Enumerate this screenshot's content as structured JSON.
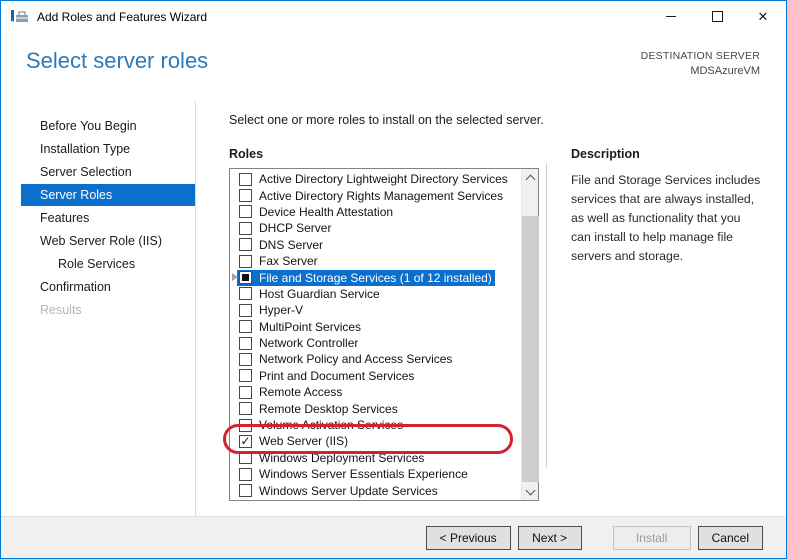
{
  "window": {
    "title": "Add Roles and Features Wizard"
  },
  "header": {
    "title": "Select server roles",
    "destination_label": "DESTINATION SERVER",
    "destination_server": "MDSAzureVM"
  },
  "sidebar": {
    "items": [
      {
        "label": "Before You Begin",
        "state": "normal"
      },
      {
        "label": "Installation Type",
        "state": "normal"
      },
      {
        "label": "Server Selection",
        "state": "normal"
      },
      {
        "label": "Server Roles",
        "state": "selected"
      },
      {
        "label": "Features",
        "state": "normal"
      },
      {
        "label": "Web Server Role (IIS)",
        "state": "normal"
      },
      {
        "label": "Role Services",
        "state": "normal",
        "indent": true
      },
      {
        "label": "Confirmation",
        "state": "normal"
      },
      {
        "label": "Results",
        "state": "disabled"
      }
    ]
  },
  "main": {
    "instruction": "Select one or more roles to install on the selected server.",
    "roles_label": "Roles",
    "roles": [
      {
        "label": "Active Directory Lightweight Directory Services",
        "checkbox": "unchecked"
      },
      {
        "label": "Active Directory Rights Management Services",
        "checkbox": "unchecked"
      },
      {
        "label": "Device Health Attestation",
        "checkbox": "unchecked"
      },
      {
        "label": "DHCP Server",
        "checkbox": "unchecked"
      },
      {
        "label": "DNS Server",
        "checkbox": "unchecked"
      },
      {
        "label": "Fax Server",
        "checkbox": "unchecked"
      },
      {
        "label": "File and Storage Services (1 of 12 installed)",
        "checkbox": "indeterminate",
        "selected": true,
        "expandable": true
      },
      {
        "label": "Host Guardian Service",
        "checkbox": "unchecked"
      },
      {
        "label": "Hyper-V",
        "checkbox": "unchecked"
      },
      {
        "label": "MultiPoint Services",
        "checkbox": "unchecked"
      },
      {
        "label": "Network Controller",
        "checkbox": "unchecked"
      },
      {
        "label": "Network Policy and Access Services",
        "checkbox": "unchecked"
      },
      {
        "label": "Print and Document Services",
        "checkbox": "unchecked"
      },
      {
        "label": "Remote Access",
        "checkbox": "unchecked"
      },
      {
        "label": "Remote Desktop Services",
        "checkbox": "unchecked"
      },
      {
        "label": "Volume Activation Services",
        "checkbox": "unchecked"
      },
      {
        "label": "Web Server (IIS)",
        "checkbox": "checked",
        "annotated": true
      },
      {
        "label": "Windows Deployment Services",
        "checkbox": "unchecked"
      },
      {
        "label": "Windows Server Essentials Experience",
        "checkbox": "unchecked"
      },
      {
        "label": "Windows Server Update Services",
        "checkbox": "unchecked"
      }
    ],
    "description": {
      "label": "Description",
      "text": "File and Storage Services includes services that are always installed, as well as functionality that you can install to help manage file servers and storage."
    }
  },
  "footer": {
    "buttons": [
      {
        "label": "< Previous",
        "enabled": true
      },
      {
        "label": "Next >",
        "enabled": true
      },
      {
        "label": "Install",
        "enabled": false
      },
      {
        "label": "Cancel",
        "enabled": true
      }
    ]
  },
  "colors": {
    "accent": "#0078d7",
    "heading": "#2e79b8",
    "selection": "#0b6fce",
    "annotation": "#d5212c",
    "disabled_text": "#b5b5b5"
  }
}
